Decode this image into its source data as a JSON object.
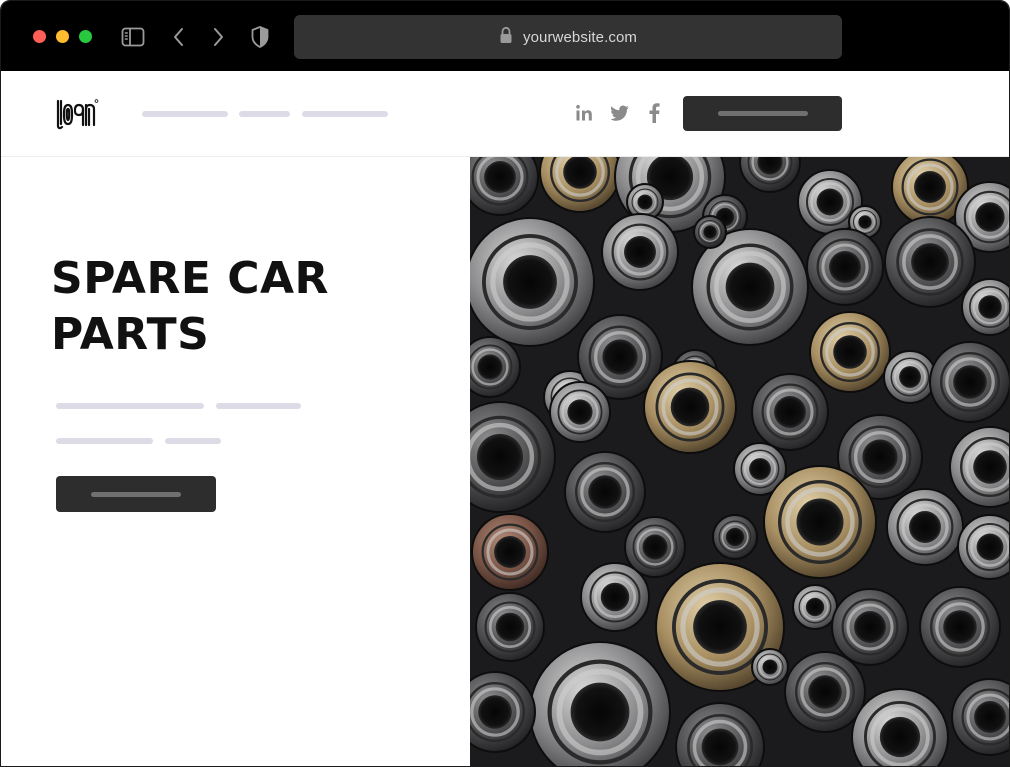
{
  "browser": {
    "url": "yourwebsite.com",
    "traffic_lights": {
      "red": "#ff5f57",
      "yellow": "#febc2e",
      "green": "#28c840"
    },
    "icons": [
      "sidebar-icon",
      "back-chevron-icon",
      "forward-chevron-icon",
      "shield-icon",
      "lock-icon"
    ]
  },
  "header": {
    "logo": "logo",
    "social_icons": [
      "linkedin-icon",
      "twitter-icon",
      "facebook-icon"
    ]
  },
  "hero": {
    "title_line1": "SPARE CAR",
    "title_line2": "PARTS",
    "image_subject": "car-parts-photo"
  },
  "colors": {
    "chrome_bg": "#000000",
    "url_bar": "#333333",
    "placeholder_line": "#dcdbe6",
    "button": "#2d2d2d",
    "title_text": "#111111"
  }
}
